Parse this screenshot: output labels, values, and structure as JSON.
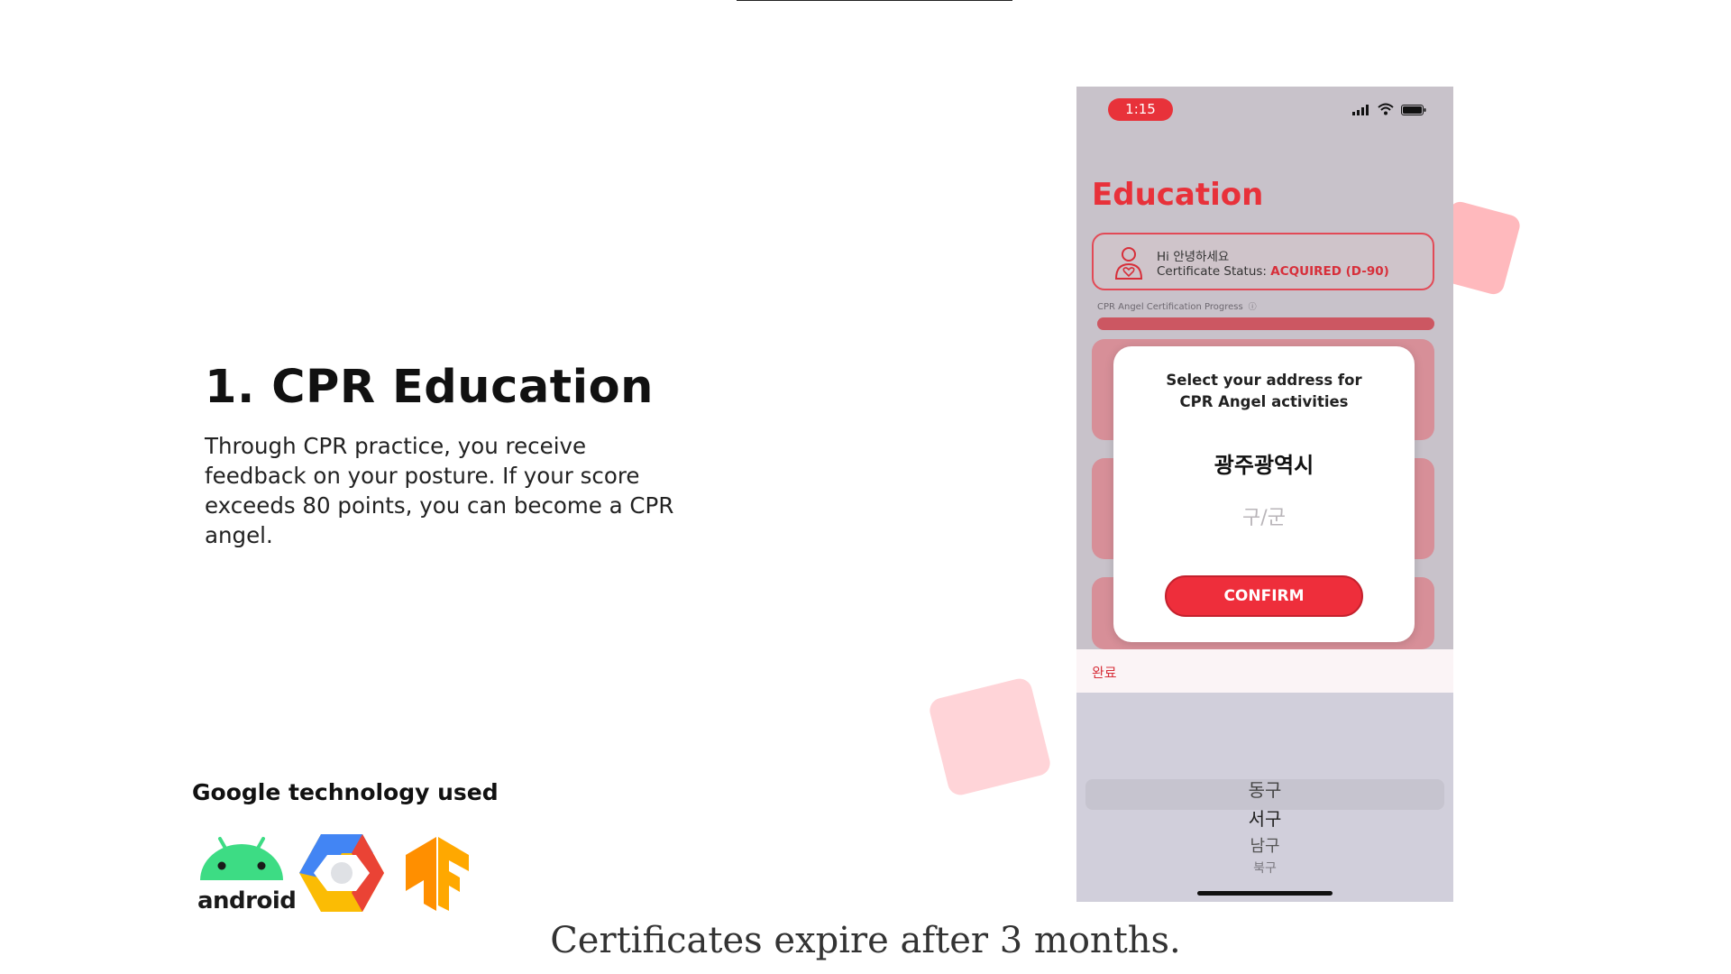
{
  "slide": {
    "heading": "1. CPR Education",
    "description": "Through CPR practice, you receive feedback on your posture. If your score exceeds 80 points, you can become a CPR angel.",
    "tech_title": "Google technology used",
    "tech_logos": [
      "android-logo",
      "google-cloud-logo",
      "tensorflow-logo"
    ],
    "android_word": "android",
    "caption": "Certificates expire after 3 months."
  },
  "phone": {
    "status_time": "1:15",
    "app_title": "Education",
    "greeting": "Hi 안녕하세요",
    "cert_prefix": "Certificate Status: ",
    "cert_status": "ACQUIRED (D-90)",
    "progress_label": "CPR Angel Certification Progress",
    "progress_fraction": 1.0,
    "modal": {
      "title": "Select your address for\nCPR Angel activities",
      "city": "광주광역시",
      "district_placeholder": "구/군",
      "confirm_label": "CONFIRM"
    },
    "done_label": "완료",
    "picker_items": [
      "동구",
      "서구",
      "남구",
      "북구"
    ]
  },
  "colors": {
    "accent": "#e8313a",
    "button": "#ee2e3b",
    "picker_bg": "#d1cfdb"
  }
}
